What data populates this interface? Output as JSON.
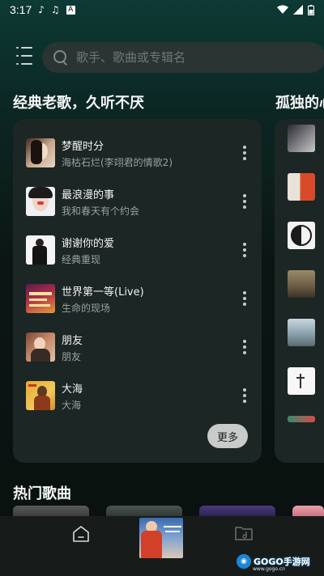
{
  "status": {
    "time": "3:17",
    "icons": [
      "tiktok-icon",
      "music-note-icon",
      "font-a-icon"
    ],
    "right_icons": [
      "wifi-icon",
      "cellular-signal-icon",
      "battery-icon"
    ]
  },
  "search": {
    "placeholder": "歌手、歌曲或专辑名"
  },
  "sections": {
    "classic_title": "经典老歌，久听不厌",
    "lonely_title": "孤独的心",
    "hot_title": "热门歌曲"
  },
  "songs": [
    {
      "title": "梦醒时分",
      "subtitle": "海枯石烂(李翊君的情歌2)"
    },
    {
      "title": "最浪漫的事",
      "subtitle": "我和春天有个约会"
    },
    {
      "title": "谢谢你的爱",
      "subtitle": "经典重现"
    },
    {
      "title": "世界第一等(Live)",
      "subtitle": "生命的现场"
    },
    {
      "title": "朋友",
      "subtitle": "朋友"
    },
    {
      "title": "大海",
      "subtitle": "大海"
    }
  ],
  "more_label": "更多",
  "colors": {
    "accent": "#1c2624",
    "background": "#0b1614",
    "bottom_bar": "#171c1b"
  },
  "watermark": {
    "text": "GOGO手游网",
    "sub": "www.gogo.cn"
  }
}
